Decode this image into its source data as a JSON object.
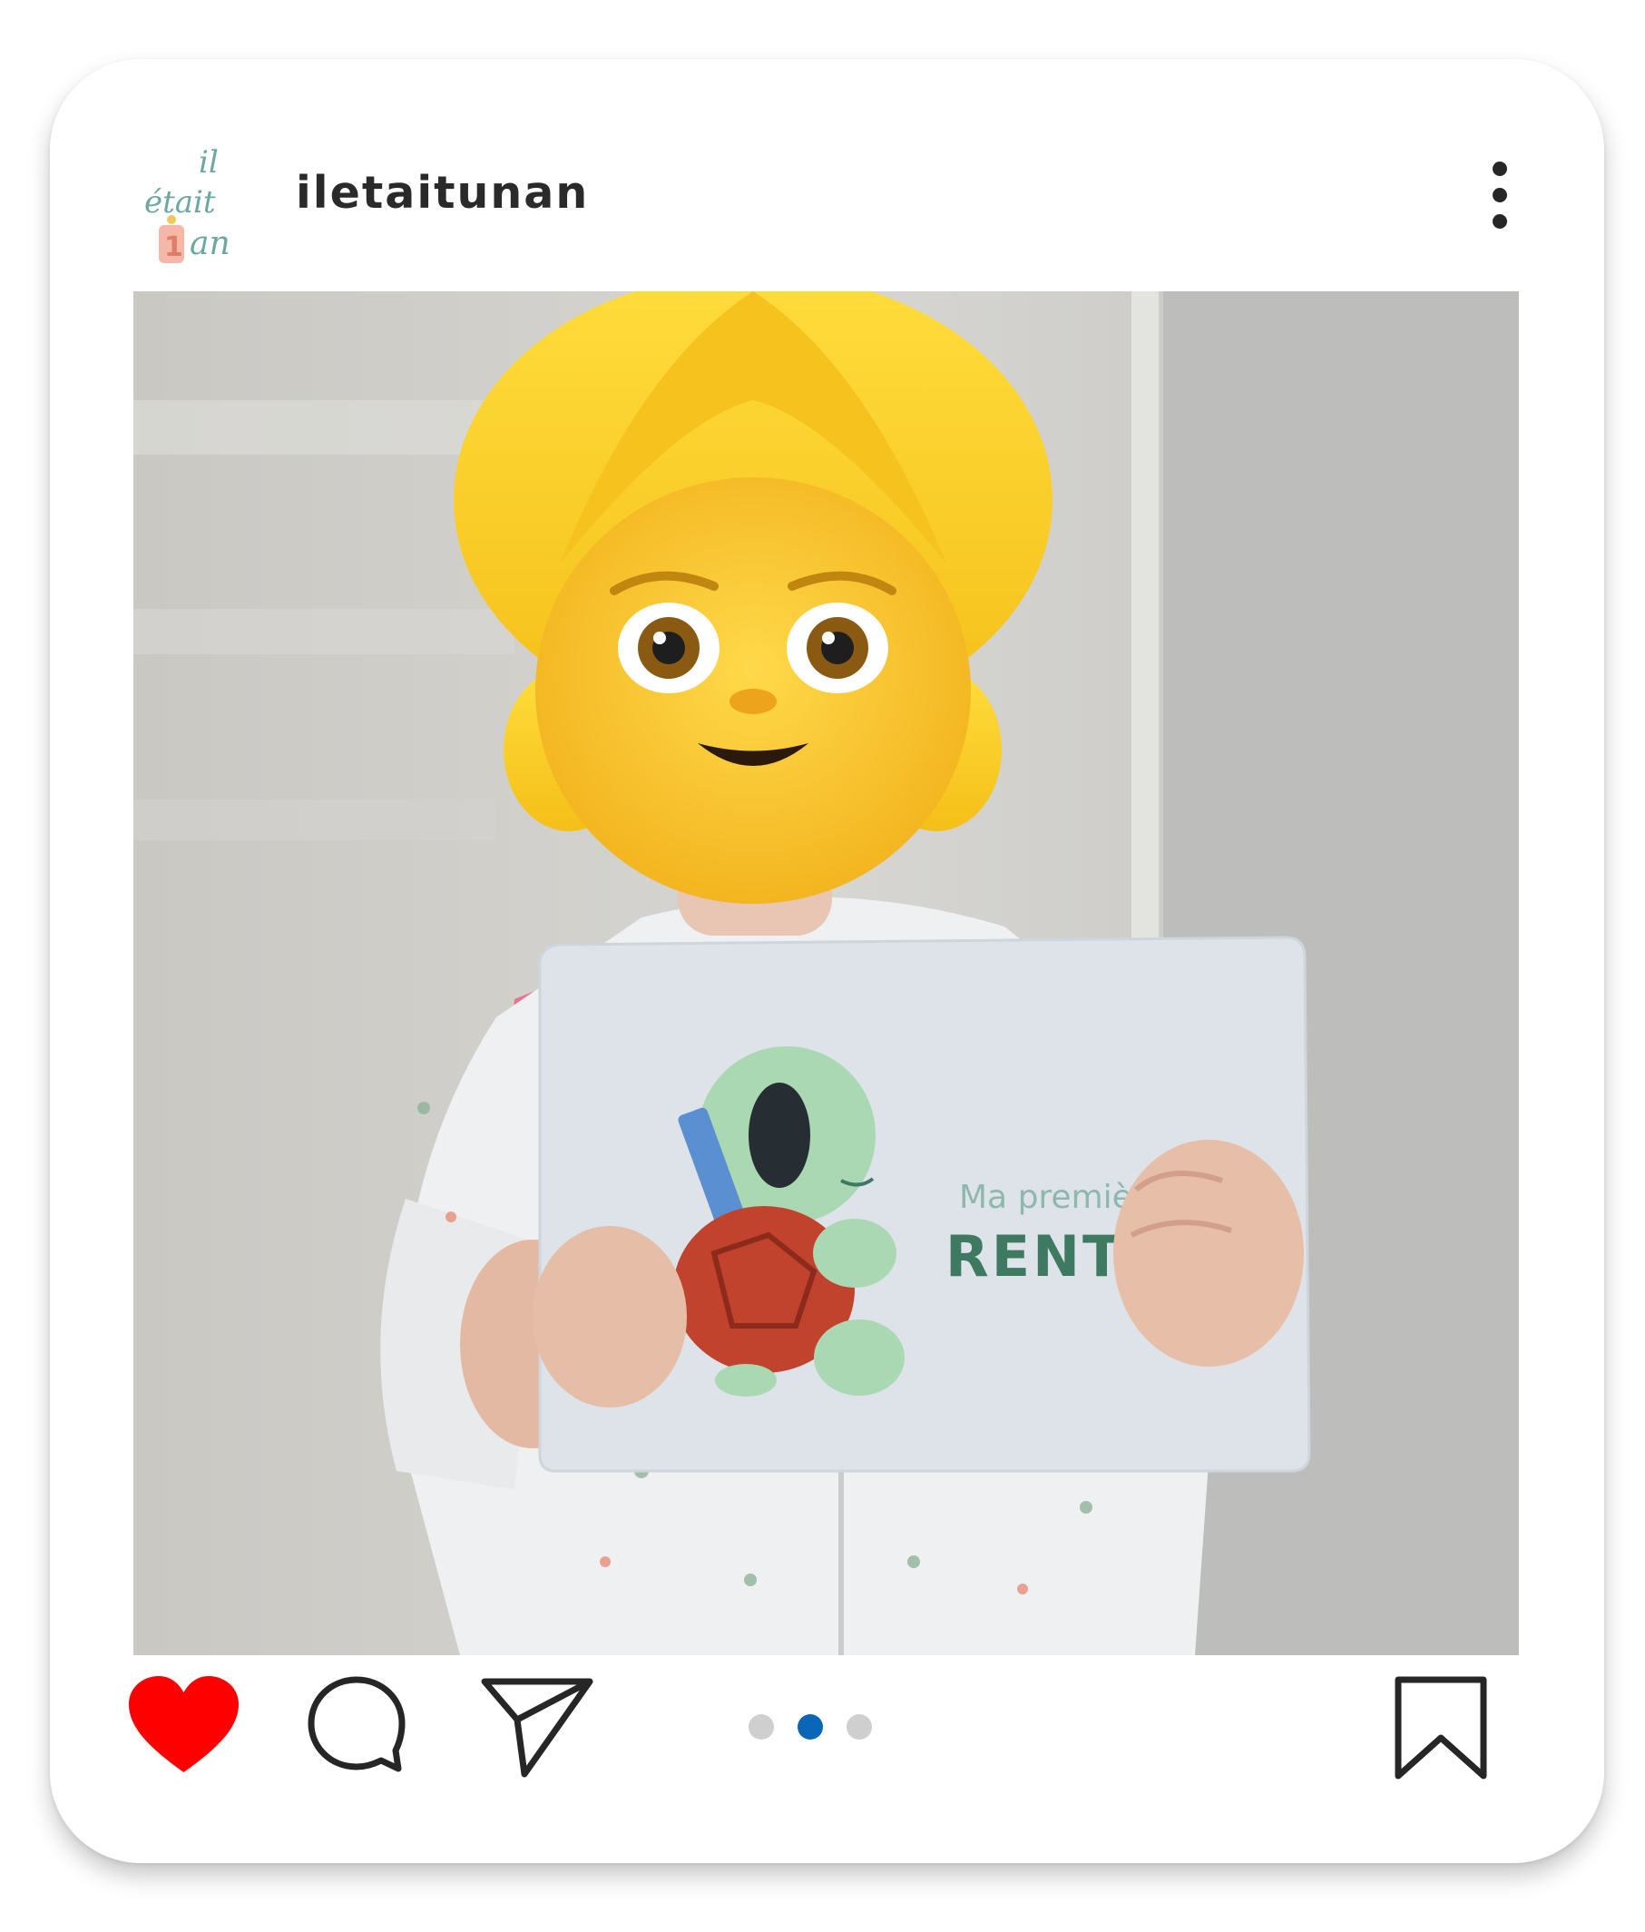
{
  "post": {
    "username": "iletaitunan",
    "avatar": {
      "logo_line_1": "il",
      "logo_line_2": "était",
      "logo_line_3": "an",
      "logo_digit": "1"
    },
    "photo": {
      "sign_text_line_1": "Ma première",
      "sign_text_line_2": "RENTRÉ"
    },
    "icons": {
      "more": "more-vertical-icon",
      "like": "heart-icon",
      "comment": "comment-icon",
      "share": "send-icon",
      "save": "bookmark-icon"
    },
    "liked": true,
    "carousel": {
      "count": 3,
      "active_index": 1
    },
    "colors": {
      "like_active": "#ff0000",
      "dot_active": "#0a67b8",
      "dot_inactive": "#cfcfcf",
      "icon_stroke": "#262626"
    }
  }
}
